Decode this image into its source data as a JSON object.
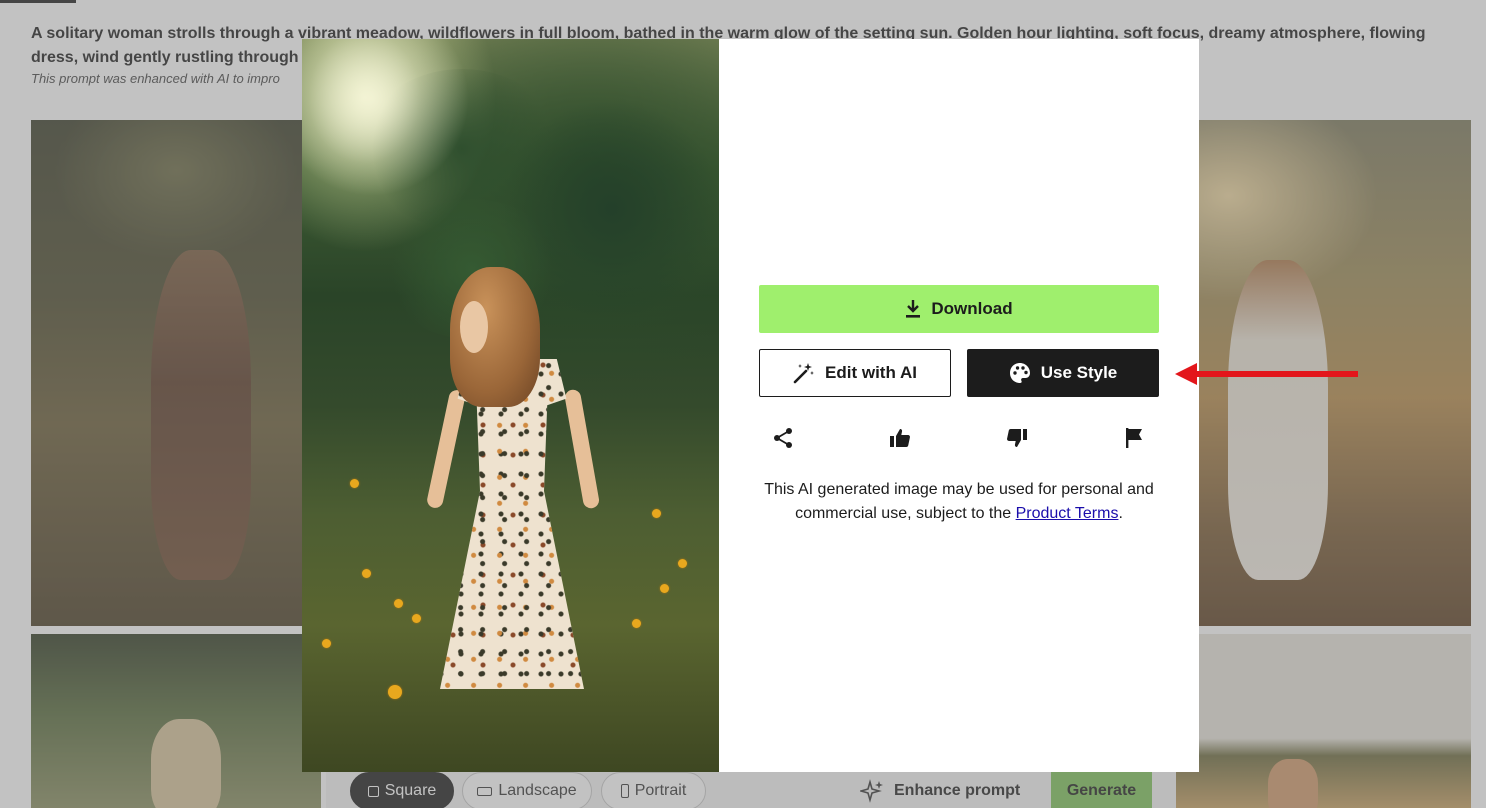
{
  "page": {
    "prompt": "A solitary woman strolls through a vibrant meadow, wildflowers in full bloom, bathed in the warm glow of the setting sun. Golden hour lighting, soft focus, dreamy atmosphere, flowing dress, wind gently rustling through the tall",
    "prompt_note": "This prompt was enhanced with AI to impro"
  },
  "toolbar": {
    "square_label": "Square",
    "landscape_label": "Landscape",
    "portrait_label": "Portrait",
    "enhance_label": "Enhance prompt",
    "generate_label": "Generate"
  },
  "modal": {
    "download_label": "Download",
    "edit_label": "Edit with AI",
    "style_label": "Use Style",
    "actions": {
      "share": "share-icon",
      "like": "thumbs-up-icon",
      "dislike": "thumbs-down-icon",
      "report": "flag-icon"
    },
    "legal_text": "This AI generated image may be used for personal and commercial use, subject to the",
    "legal_link": "Product Terms",
    "legal_end": "."
  },
  "colors": {
    "download_bg": "#9fef6d",
    "style_bg": "#1c1c1c",
    "annotation_arrow": "#e3161b",
    "generate_bg": "#7fc45a"
  }
}
